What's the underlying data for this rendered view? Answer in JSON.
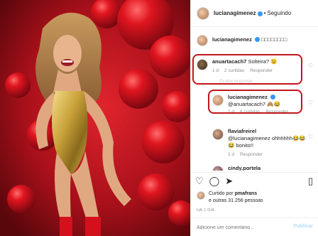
{
  "post": {
    "username": "lucianagimenez",
    "separator": "•",
    "follow_status": "Seguindo"
  },
  "caption": {
    "username": "lucianagimenez",
    "text": "□□□□□□□□"
  },
  "comments": [
    {
      "username": "anuartacach7",
      "text": "Solteira? 😉",
      "time": "1 d",
      "likes": "2 curtidas",
      "reply": "Responder",
      "faded": "Ocultar respostas"
    },
    {
      "username": "lucianagimenez",
      "text": "@anuartacach7 🙈😂",
      "time": "1 d",
      "likes": "6 curtidas",
      "reply": "Responder"
    },
    {
      "username": "flaviafreirel",
      "text": "@lucianagimenez ohhhhhh😂😂😂 bonito!!",
      "time": "1 d",
      "reply": "Responder"
    },
    {
      "username": "cindy.portela",
      "text": ""
    }
  ],
  "likes_summary": {
    "prefix": "Curtido por",
    "user": "pmafrans",
    "suffix": "e outras 31.256 pessoas"
  },
  "post_date": "HÁ 1 DIA",
  "add_comment": {
    "placeholder": "Adicione um comentário...",
    "publish": "Publicar"
  },
  "icons": {
    "verified": "verified-badge-icon",
    "heart": "heart-icon",
    "comment": "comment-icon",
    "share": "share-icon",
    "save": "bookmark-icon"
  },
  "colors": {
    "highlight_box": "#c0161b",
    "verified_blue": "#3897f0",
    "swimsuit_gold": "#c9a23a",
    "background_red": "#b3121c"
  }
}
